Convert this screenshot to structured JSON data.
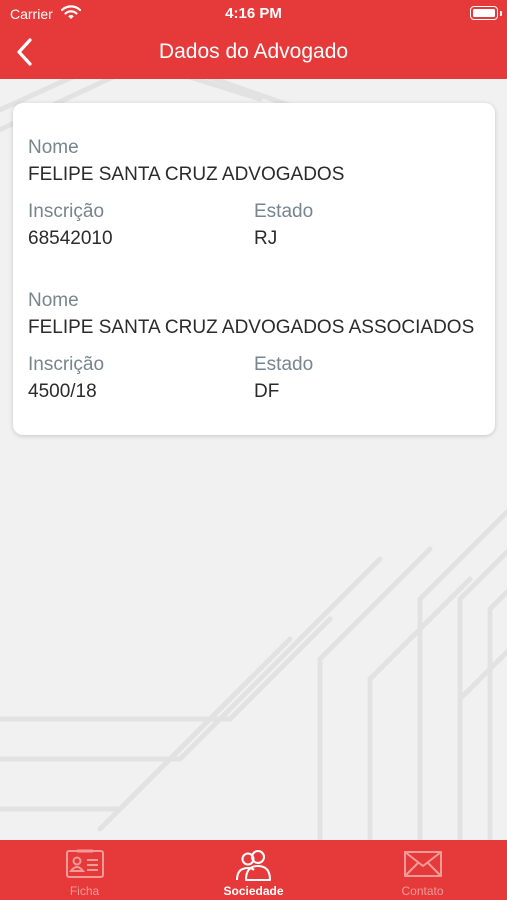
{
  "status_bar": {
    "carrier": "Carrier",
    "time": "4:16 PM"
  },
  "nav": {
    "title": "Dados do Advogado"
  },
  "entries": [
    {
      "name_label": "Nome",
      "name": "FELIPE SANTA CRUZ ADVOGADOS",
      "inscricao_label": "Inscrição",
      "inscricao": "68542010",
      "estado_label": "Estado",
      "estado": "RJ"
    },
    {
      "name_label": "Nome",
      "name": "FELIPE SANTA CRUZ ADVOGADOS ASSOCIADOS",
      "inscricao_label": "Inscrição",
      "inscricao": "4500/18",
      "estado_label": "Estado",
      "estado": "DF"
    }
  ],
  "tabs": [
    {
      "label": "Ficha",
      "icon": "id-card-icon",
      "active": false
    },
    {
      "label": "Sociedade",
      "icon": "people-icon",
      "active": true
    },
    {
      "label": "Contato",
      "icon": "envelope-icon",
      "active": false
    }
  ],
  "colors": {
    "accent": "#e6393a",
    "label": "#77858d",
    "text": "#2b2b2b",
    "background": "#f1f1f1"
  }
}
